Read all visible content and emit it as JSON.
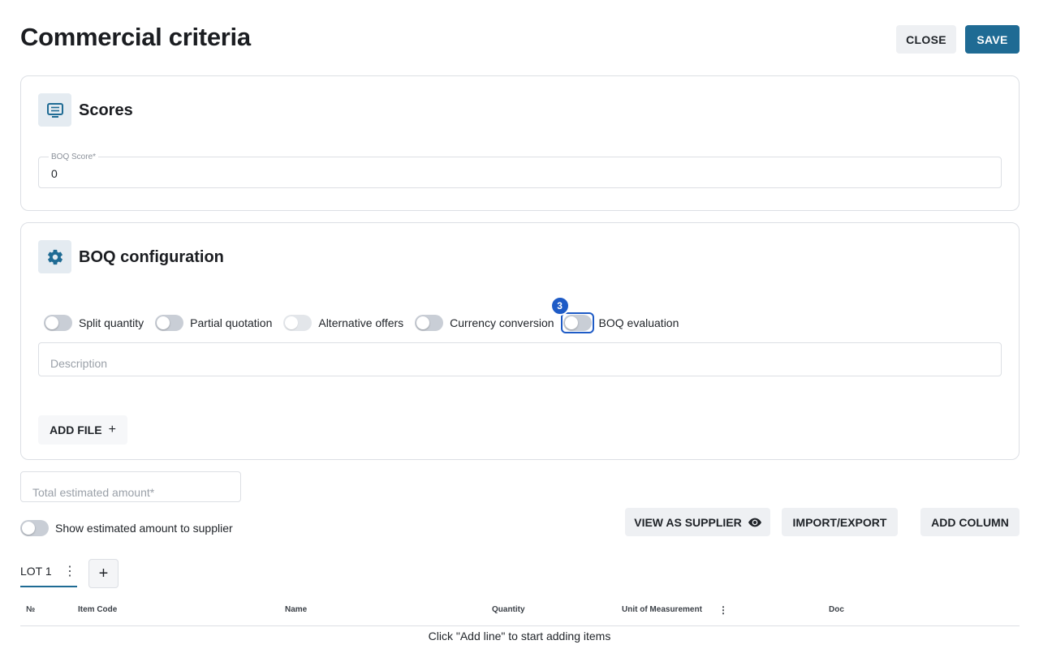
{
  "header": {
    "title": "Commercial criteria",
    "close_label": "CLOSE",
    "save_label": "SAVE"
  },
  "scores": {
    "title": "Scores",
    "icon": "scores-icon",
    "boq_score_label": "BOQ Score*",
    "boq_score_value": "0"
  },
  "boq_config": {
    "title": "BOQ configuration",
    "icon": "gear-icon",
    "toggles": [
      {
        "label": "Split quantity",
        "on": false,
        "disabled": false
      },
      {
        "label": "Partial quotation",
        "on": false,
        "disabled": false
      },
      {
        "label": "Alternative offers",
        "on": false,
        "disabled": true
      },
      {
        "label": "Currency conversion",
        "on": false,
        "disabled": false
      },
      {
        "label": "BOQ evaluation",
        "on": false,
        "disabled": false,
        "badge": "3"
      }
    ],
    "description_placeholder": "Description",
    "add_file_label": "ADD FILE"
  },
  "estimate": {
    "total_placeholder": "Total estimated amount*",
    "show_toggle_label": "Show estimated amount to supplier"
  },
  "actions": {
    "view_as_supplier": "VIEW AS SUPPLIER",
    "import_export": "IMPORT/EXPORT",
    "add_column": "ADD COLUMN"
  },
  "tabs": {
    "active_label": "LOT 1",
    "add_label": "+"
  },
  "table": {
    "columns": [
      "№",
      "Item Code",
      "Name",
      "Quantity",
      "Unit of Measurement",
      "Doc"
    ],
    "empty_message": "Click \"Add line\" to start adding items"
  },
  "colors": {
    "accent": "#1f6b94",
    "focus": "#1e5bc6"
  }
}
